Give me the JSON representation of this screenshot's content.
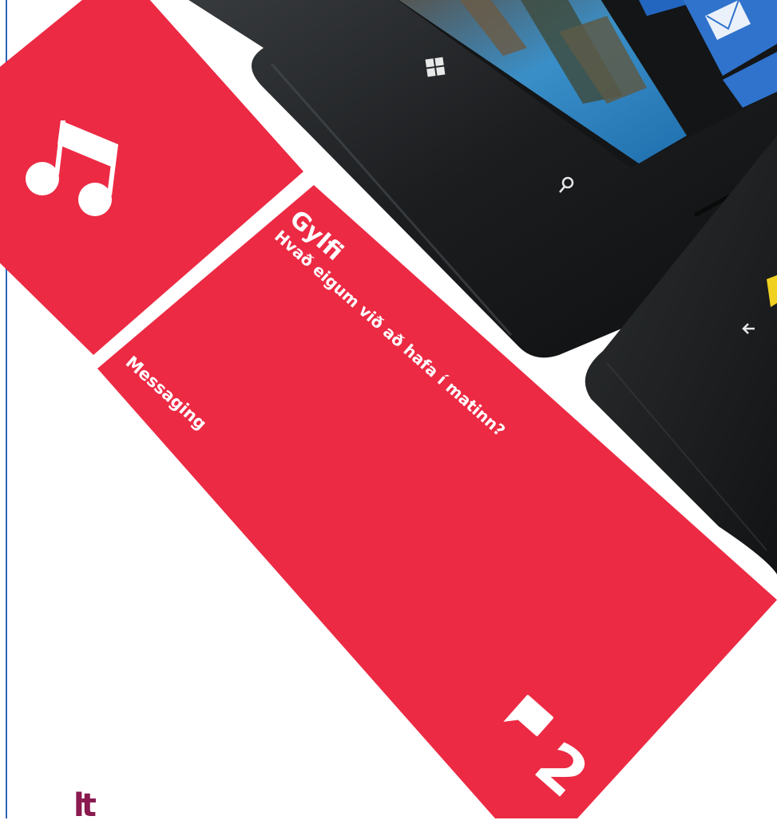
{
  "colors": {
    "tile_red": "#ec2a44",
    "phone_body": "#1e2022",
    "accent_blue": "#2a66b8",
    "logo": "#8a1a4f"
  },
  "music_tile": {
    "icon": "music-note-icon"
  },
  "messaging_tile": {
    "label": "Messaging",
    "sender": "Gylfi",
    "message": "Hvað eigum við að hafa í matinn?",
    "count": "2",
    "icon": "speech-bubble-icon"
  },
  "phone": {
    "start_icon": "windows-logo-icon",
    "search_icon": "search-icon",
    "back_icon": "back-arrow-icon"
  },
  "logo": {
    "text": "lt"
  }
}
